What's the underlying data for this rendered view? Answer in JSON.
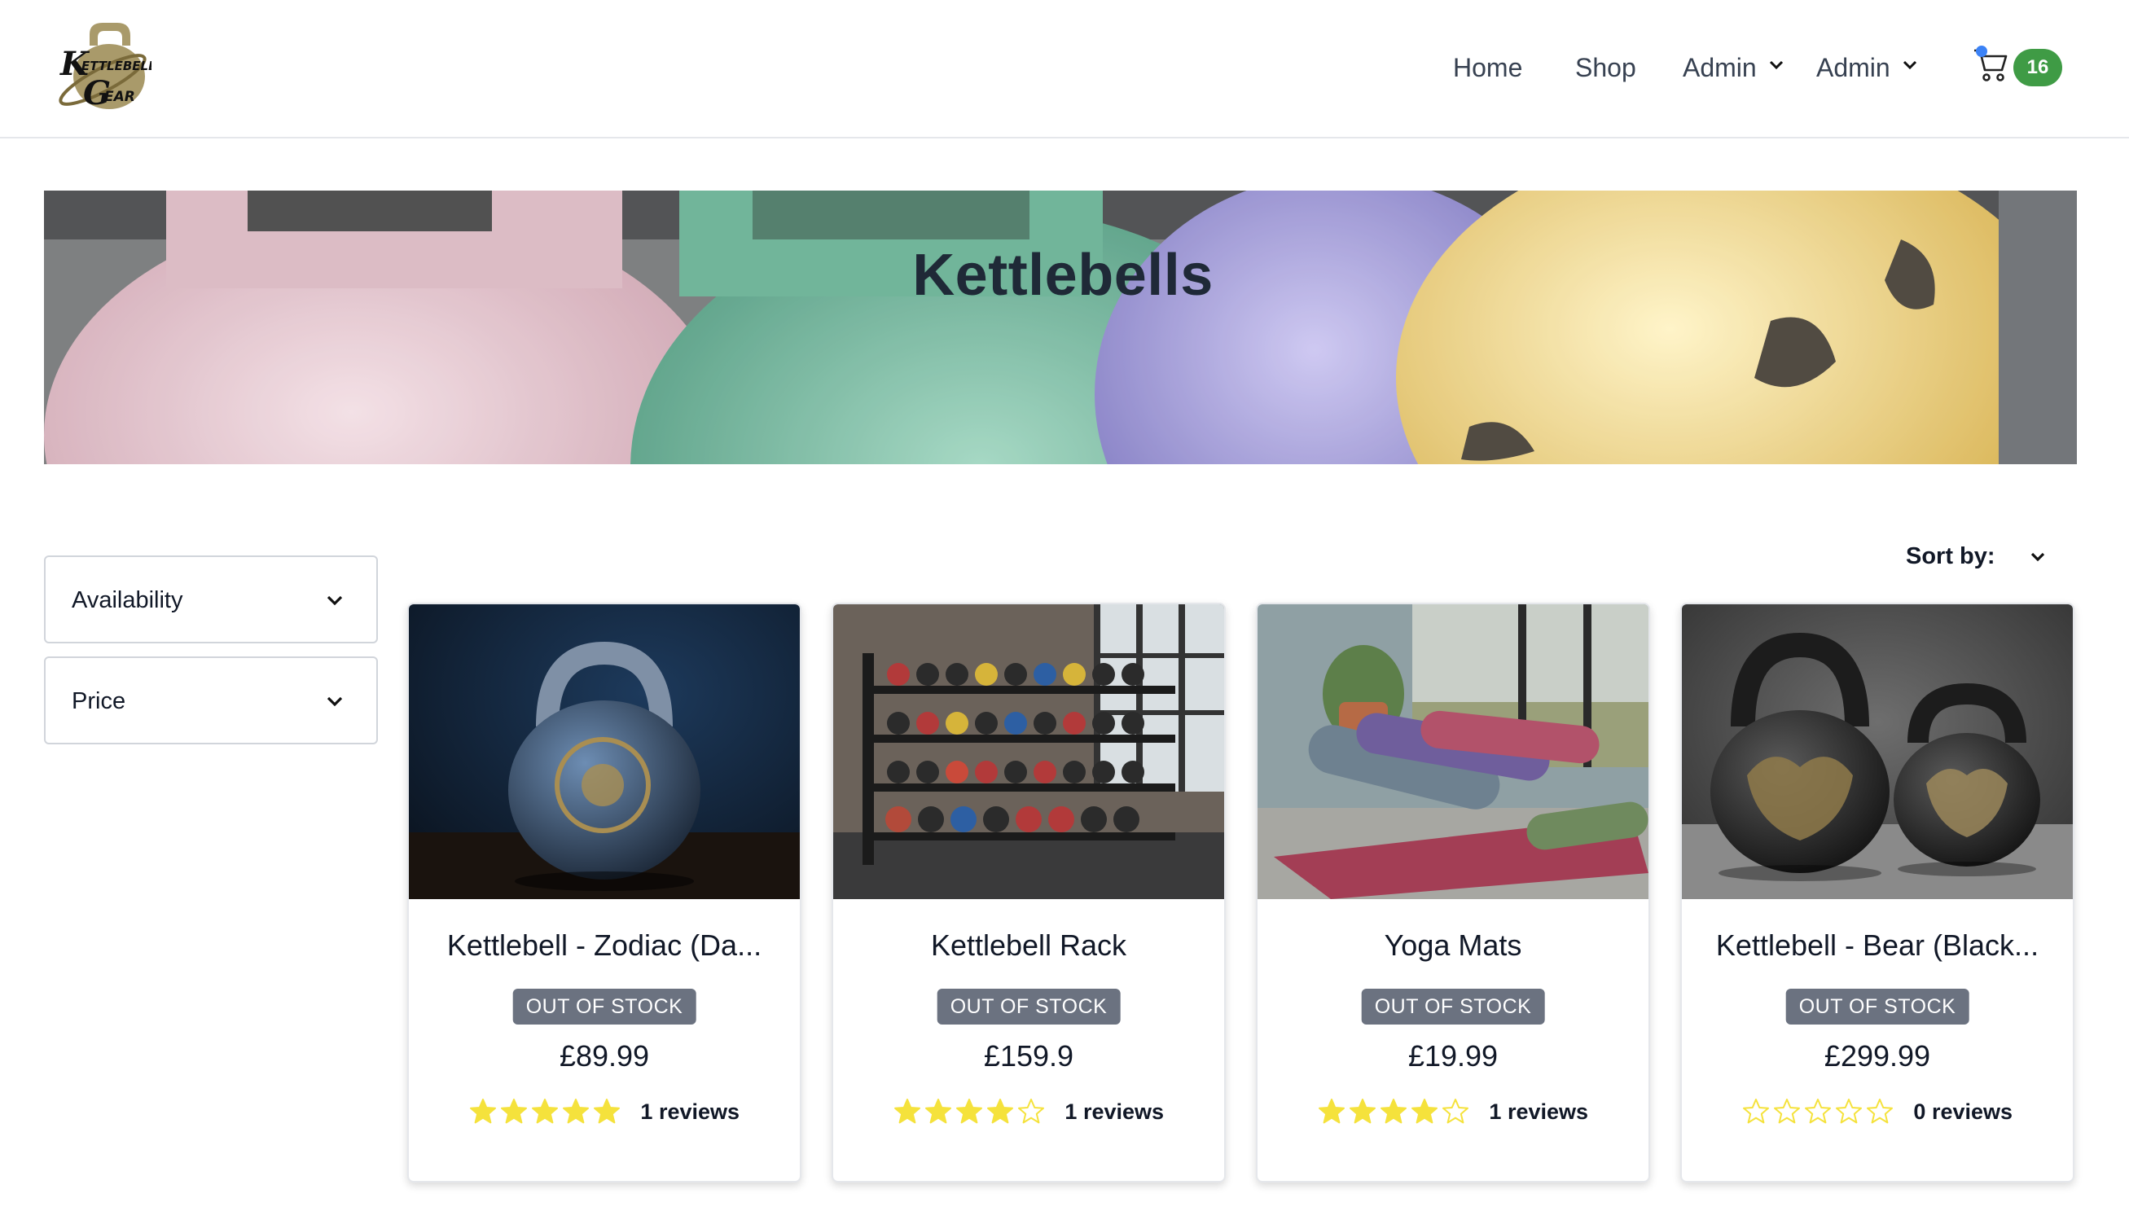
{
  "header": {
    "logo_text": [
      "KETTLEBELL",
      "GEAR"
    ],
    "nav": [
      {
        "label": "Home"
      },
      {
        "label": "Shop"
      },
      {
        "label": "Admin"
      },
      {
        "label": "Admin"
      }
    ],
    "cart_count": "16"
  },
  "hero": {
    "title": "Kettlebells"
  },
  "filters": [
    {
      "label": "Availability"
    },
    {
      "label": "Price"
    }
  ],
  "sort": {
    "label": "Sort by:"
  },
  "products": [
    {
      "name": "Kettlebell - Zodiac (Da...",
      "stock": "OUT OF STOCK",
      "price": "£89.99",
      "rating": 5,
      "reviews": "1 reviews",
      "image": "zodiac-kettlebell"
    },
    {
      "name": "Kettlebell Rack",
      "stock": "OUT OF STOCK",
      "price": "£159.9",
      "rating": 4,
      "reviews": "1 reviews",
      "image": "kettlebell-rack"
    },
    {
      "name": "Yoga Mats",
      "stock": "OUT OF STOCK",
      "price": "£19.99",
      "rating": 4,
      "reviews": "1 reviews",
      "image": "yoga-mats"
    },
    {
      "name": "Kettlebell - Bear (Black...",
      "stock": "OUT OF STOCK",
      "price": "£299.99",
      "rating": 0,
      "reviews": "0 reviews",
      "image": "bear-kettlebells"
    }
  ],
  "colors": {
    "star_filled": "#f5e23c",
    "badge": "#6b7280",
    "cart_badge": "#3f9b45",
    "cart_dot": "#3b82f6"
  }
}
